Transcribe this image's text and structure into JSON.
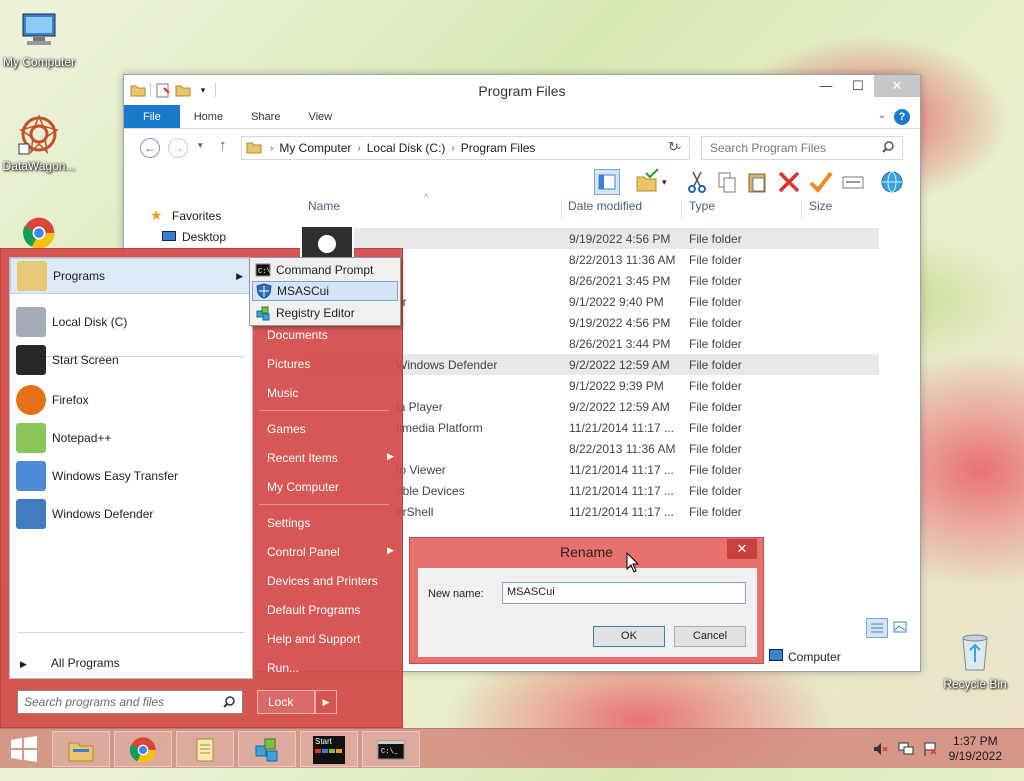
{
  "desktop": {
    "icons": [
      {
        "label": "My Computer"
      },
      {
        "label": "DataWagon..."
      },
      {
        "label": "Recycle Bin"
      }
    ]
  },
  "explorer": {
    "title": "Program Files",
    "tabs": [
      "File",
      "Home",
      "Share",
      "View"
    ],
    "help": "?",
    "address": [
      "My Computer",
      "Local Disk (C:)",
      "Program Files"
    ],
    "search_placeholder": "Search Program Files",
    "nav_pane": {
      "favorites": "Favorites",
      "desktop": "Desktop"
    },
    "columns": {
      "name": "Name",
      "date": "Date modified",
      "type": "Type",
      "size": "Size"
    },
    "rows": [
      {
        "name": "",
        "date": "9/19/2022 4:56 PM",
        "type": "File folder"
      },
      {
        "name": "",
        "date": "8/22/2013 11:36 AM",
        "type": "File folder"
      },
      {
        "name": "",
        "date": "8/26/2021 3:45 PM",
        "type": "File folder"
      },
      {
        "name": "er",
        "date": "9/1/2022 9:40 PM",
        "type": "File folder"
      },
      {
        "name": "",
        "date": "9/19/2022 4:56 PM",
        "type": "File folder"
      },
      {
        "name": "",
        "date": "8/26/2021 3:44 PM",
        "type": "File folder"
      },
      {
        "name": "Windows Defender",
        "date": "9/2/2022 12:59 AM",
        "type": "File folder"
      },
      {
        "name": "",
        "date": "9/1/2022 9:39 PM",
        "type": "File folder"
      },
      {
        "name": "ia Player",
        "date": "9/2/2022 12:59 AM",
        "type": "File folder"
      },
      {
        "name": "timedia Platform",
        "date": "11/21/2014 11:17 ...",
        "type": "File folder"
      },
      {
        "name": "",
        "date": "8/22/2013 11:36 AM",
        "type": "File folder"
      },
      {
        "name": "to Viewer",
        "date": "11/21/2014 11:17 ...",
        "type": "File folder"
      },
      {
        "name": "able Devices",
        "date": "11/21/2014 11:17 ...",
        "type": "File folder"
      },
      {
        "name": "erShell",
        "date": "11/21/2014 11:17 ...",
        "type": "File folder"
      }
    ],
    "status_location": "Computer"
  },
  "start_menu": {
    "left_items": [
      {
        "label": "Programs",
        "icon": "folder-icon"
      },
      {
        "label": "Local Disk (C)",
        "icon": "disk-icon"
      },
      {
        "label": "Start Screen",
        "icon": "start-screen-icon"
      },
      {
        "label": "Firefox",
        "icon": "firefox-icon"
      },
      {
        "label": "Notepad++",
        "icon": "notepadpp-icon"
      },
      {
        "label": "Windows Easy Transfer",
        "icon": "easy-transfer-icon"
      },
      {
        "label": "Windows Defender",
        "icon": "defender-icon"
      }
    ],
    "all_programs": "All Programs",
    "search_placeholder": "Search programs and files",
    "right_items": [
      "Documents",
      "Pictures",
      "Music",
      "Games",
      "Recent Items",
      "My Computer",
      "Settings",
      "Control Panel",
      "Devices and Printers",
      "Default Programs",
      "Help and Support",
      "Run..."
    ],
    "lock": "Lock"
  },
  "programs_submenu": [
    "Command Prompt",
    "MSASCui",
    "Registry Editor"
  ],
  "rename_dialog": {
    "title": "Rename",
    "label": "New name:",
    "value": "MSASCui",
    "ok": "OK",
    "cancel": "Cancel",
    "close": "✕"
  },
  "taskbar": {
    "time": "1:37 PM",
    "date": "9/19/2022",
    "start_thumb": "Start"
  }
}
